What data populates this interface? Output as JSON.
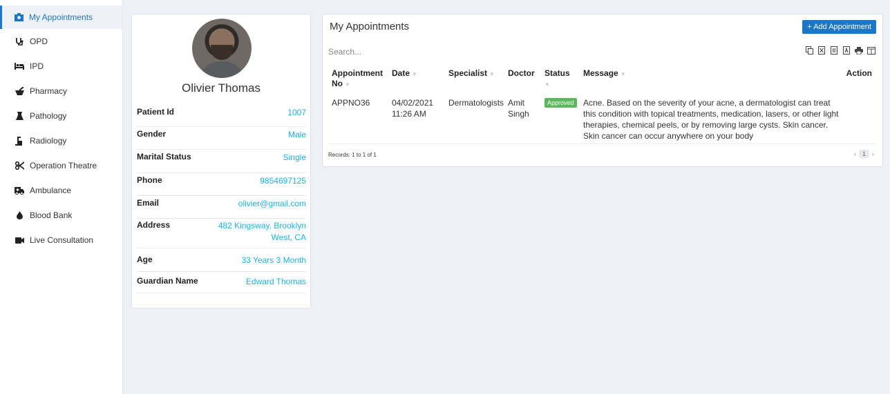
{
  "sidebar": {
    "items": [
      {
        "label": "My Appointments",
        "icon": "hospital-icon"
      },
      {
        "label": "OPD",
        "icon": "stethoscope-icon"
      },
      {
        "label": "IPD",
        "icon": "bed-icon"
      },
      {
        "label": "Pharmacy",
        "icon": "mortar-pestle-icon"
      },
      {
        "label": "Pathology",
        "icon": "flask-icon"
      },
      {
        "label": "Radiology",
        "icon": "xray-icon"
      },
      {
        "label": "Operation Theatre",
        "icon": "scissors-icon"
      },
      {
        "label": "Ambulance",
        "icon": "ambulance-icon"
      },
      {
        "label": "Blood Bank",
        "icon": "blood-drop-icon"
      },
      {
        "label": "Live Consultation",
        "icon": "video-camera-icon"
      }
    ]
  },
  "profile": {
    "name": "Olivier Thomas",
    "fields": [
      {
        "label": "Patient Id",
        "value": "1007"
      },
      {
        "label": "Gender",
        "value": "Male"
      },
      {
        "label": "Marital Status",
        "value": "Single"
      },
      {
        "label": "Phone",
        "value": "9854697125"
      },
      {
        "label": "Email",
        "value": "olivier@gmail.com"
      },
      {
        "label": "Address",
        "value": "482 Kingsway, Brooklyn West, CA"
      },
      {
        "label": "Age",
        "value": "33 Years 3 Month"
      },
      {
        "label": "Guardian Name",
        "value": "Edward Thomas"
      }
    ]
  },
  "appointments": {
    "title": "My Appointments",
    "add_label": "+ Add Appointment",
    "search_placeholder": "Search...",
    "columns": {
      "no": "Appointment No",
      "date": "Date",
      "specialist": "Specialist",
      "doctor": "Doctor",
      "status": "Status",
      "message": "Message",
      "action": "Action"
    },
    "rows": [
      {
        "no": "APPNO36",
        "date": "04/02/2021 11:26 AM",
        "specialist": "Dermatologists",
        "doctor": "Amit Singh",
        "status": "Approved",
        "message": "Acne. Based on the severity of your acne, a dermatologist can treat this condition with topical treatments, medication, lasers, or other light therapies, chemical peels, or by removing large cysts. Skin cancer. Skin cancer can occur anywhere on your body"
      }
    ],
    "records_text": "Records: 1 to 1 of 1",
    "page": "1",
    "status_color": "#5cb85c",
    "accent_color": "#1b76c8",
    "link_color": "#1bb2e8"
  }
}
